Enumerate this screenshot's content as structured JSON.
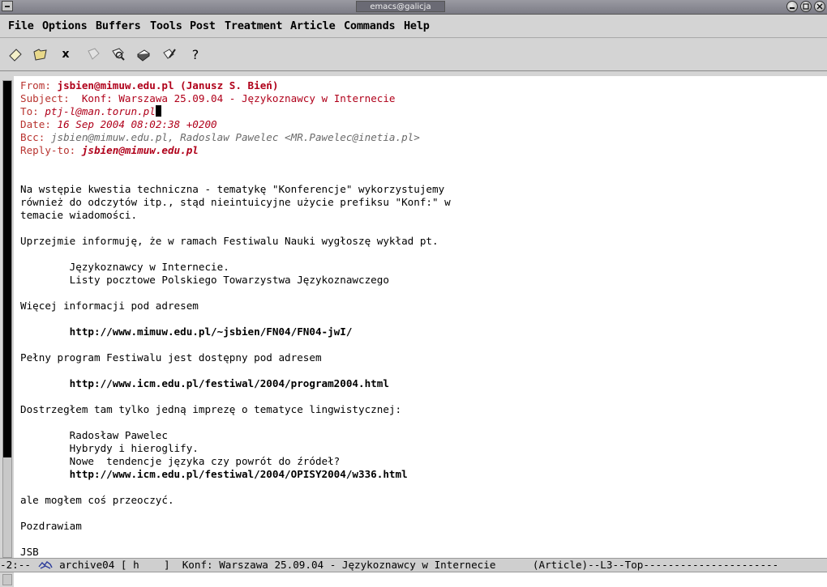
{
  "window": {
    "title": "emacs@galicja"
  },
  "menu": [
    "File",
    "Options",
    "Buffers",
    "Tools",
    "Post",
    "Treatment",
    "Article",
    "Commands",
    "Help"
  ],
  "toolbar": {
    "close_glyph": "x",
    "help_glyph": "?"
  },
  "headers": {
    "from_label": "From: ",
    "from_value": "jsbien@mimuw.edu.pl (Janusz S. Bień)",
    "subject_label": "Subject: ",
    "subject_value": " Konf: Warszawa 25.09.04 - Językoznawcy w Internecie",
    "to_label": "To: ",
    "to_value": "ptj-l@man.torun.pl",
    "date_label": "Date: ",
    "date_value": "16 Sep 2004 08:02:38 +0200",
    "bcc_label": "Bcc: ",
    "bcc_value": "jsbien@mimuw.edu.pl, Radoslaw Pawelec <MR.Pawelec@inetia.pl>",
    "replyto_label": "Reply-to: ",
    "replyto_value": "jsbien@mimuw.edu.pl"
  },
  "body": {
    "p1_l1": "Na wstępie kwestia techniczna - tematykę \"Konferencje\" wykorzystujemy",
    "p1_l2": "również do odczytów itp., stąd nieintuicyjne użycie prefiksu \"Konf:\" w",
    "p1_l3": "temacie wiadomości.",
    "p2": "Uprzejmie informuję, że w ramach Festiwalu Nauki wygłoszę wykład pt.",
    "talk_l1": "        Językoznawcy w Internecie.",
    "talk_l2": "        Listy pocztowe Polskiego Towarzystwa Językoznawczego",
    "p3": "Więcej informacji pod adresem",
    "url1": "        http://www.mimuw.edu.pl/~jsbien/FN04/FN04-jwI/",
    "p4": "Pełny program Festiwalu jest dostępny pod adresem",
    "url2": "        http://www.icm.edu.pl/festiwal/2004/program2004.html",
    "p5": "Dostrzegłem tam tylko jedną imprezę o tematyce lingwistycznej:",
    "ev_l1": "        Radosław Pawelec",
    "ev_l2": "        Hybrydy i hieroglify.",
    "ev_l3": "        Nowe  tendencje języka czy powrót do źródeł?",
    "url3": "        http://www.icm.edu.pl/festiwal/2004/OPISY2004/w336.html",
    "p6": "ale mogłem coś przeoczyć.",
    "p7": "Pozdrawiam",
    "sig": "JSB"
  },
  "modeline": {
    "prefix": "-2:-- ",
    "buffer": " archive04 [ h    ]  Konf: Warszawa 25.09.04 - Językoznawcy w Internecie      (Article)--L3--Top----------------------"
  },
  "colors": {
    "header_red": "#b0001a",
    "header_gray": "#6a6a6a",
    "gnus_icon": "#2a3a9a"
  }
}
